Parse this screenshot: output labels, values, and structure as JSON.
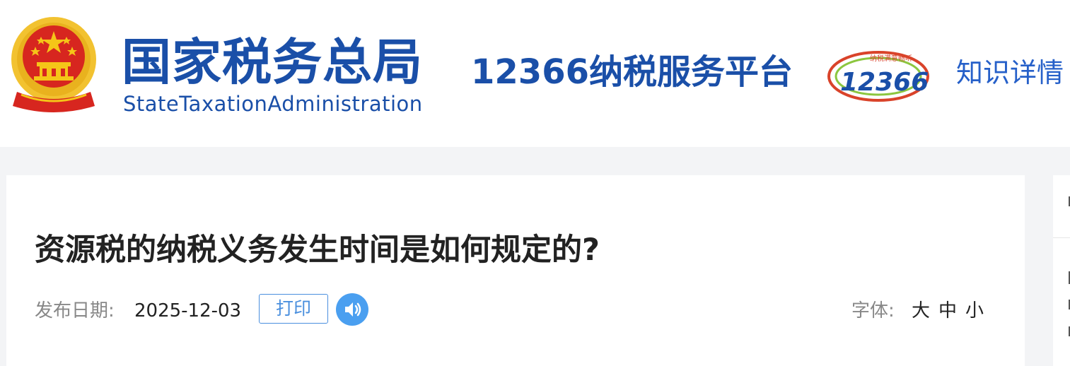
{
  "header": {
    "org_name_cn": "国家税务总局",
    "org_name_en": "StateTaxationAdministration",
    "platform_title": "12366纳税服务平台",
    "platform_logo_text": "12366",
    "nav_link": "知识详情"
  },
  "article": {
    "title": "资源税的纳税义务发生时间是如何规定的?",
    "date_label": "发布日期:",
    "date_value": "2025-12-03",
    "print_label": "打印",
    "font_label": "字体:",
    "font_large": "大",
    "font_medium": "中",
    "font_small": "小"
  },
  "colors": {
    "brand_blue": "#1a4fa8",
    "link_blue": "#2660c9",
    "accent_blue": "#4a8fde",
    "emblem_red": "#d7261f",
    "emblem_gold": "#f5c518"
  }
}
